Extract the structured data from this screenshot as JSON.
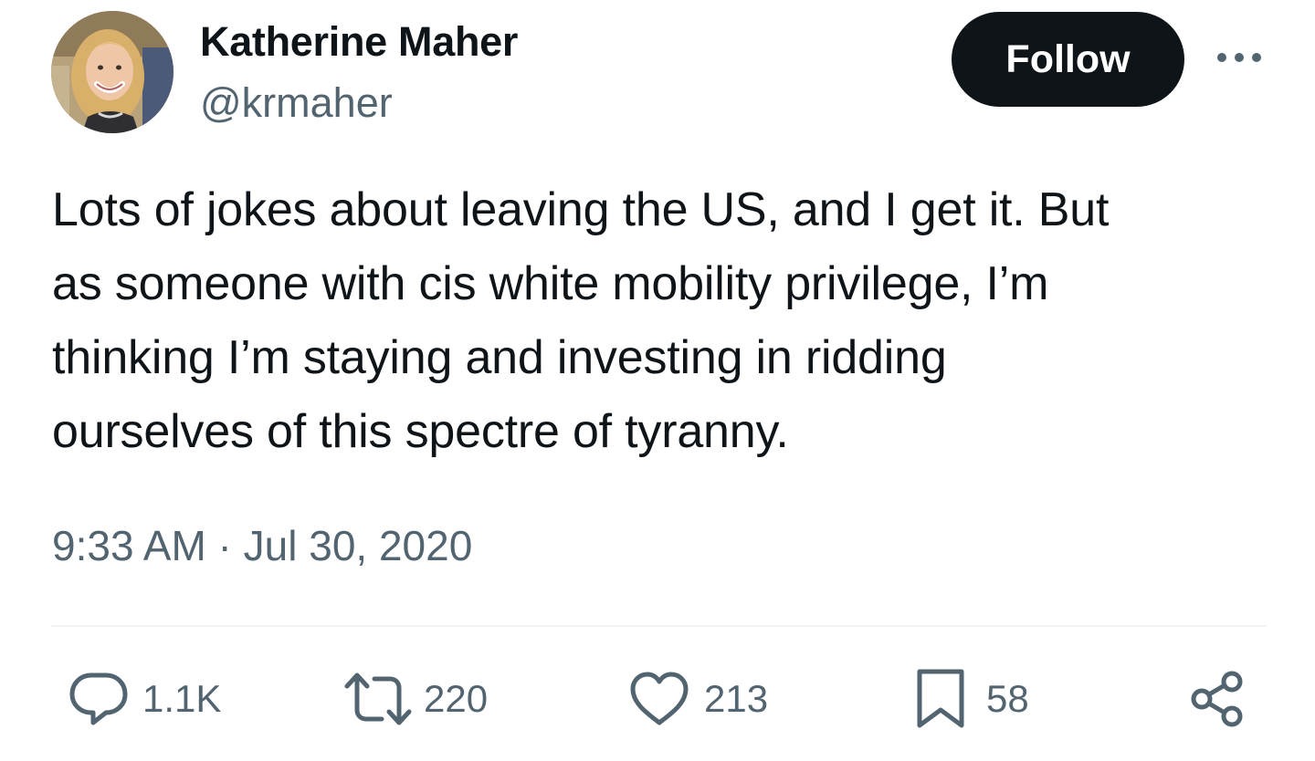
{
  "author": {
    "display_name": "Katherine Maher",
    "handle": "@krmaher",
    "avatar_icon": "avatar-photo"
  },
  "follow_button": {
    "label": "Follow"
  },
  "more_icon": "more-horizontal-icon",
  "tweet": {
    "text_lines": [
      "Lots of jokes about leaving the US, and I get it. But",
      "as someone with cis white mobility privilege, I’m",
      "thinking I’m staying and investing in ridding",
      "ourselves of this spectre of tyranny."
    ],
    "timestamp": "9:33 AM · Jul 30, 2020"
  },
  "actions": {
    "reply": {
      "icon": "reply-icon",
      "count": "1.1K"
    },
    "retweet": {
      "icon": "retweet-icon",
      "count": "220"
    },
    "like": {
      "icon": "heart-icon",
      "count": "213"
    },
    "bookmark": {
      "icon": "bookmark-icon",
      "count": "58"
    },
    "share": {
      "icon": "share-icon"
    }
  },
  "colors": {
    "text_primary": "#0f1419",
    "text_secondary": "#536471",
    "button_bg": "#0f1419",
    "button_text": "#ffffff",
    "divider": "#eff3f4"
  }
}
